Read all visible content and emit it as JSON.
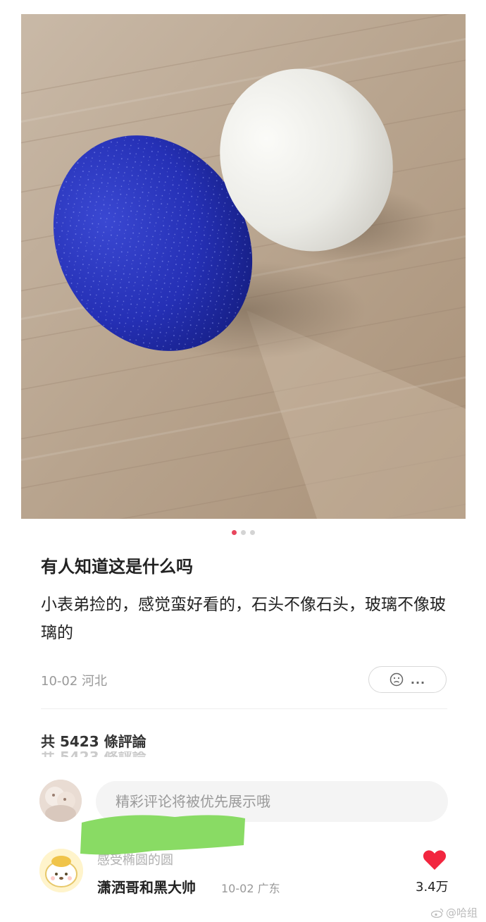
{
  "post": {
    "title": "有人知道这是什么吗",
    "body": "小表弟捡的，感觉蛮好看的，石头不像石头，玻璃不像玻璃的",
    "meta": "10-02 河北",
    "reaction_more": "..."
  },
  "carousel": {
    "total": 3,
    "active_index": 0
  },
  "comments": {
    "count_label": "共 5423 條評論",
    "input_placeholder": "精彩评论将被优先展示哦",
    "top_comment": {
      "faded_text": "感受椭圆的圆",
      "text": "潇洒哥和黑大帅",
      "time": "10-02 广东",
      "likes": "3.4万"
    }
  },
  "watermark": {
    "text": "@哈组"
  },
  "colors": {
    "accent": "#e8465d",
    "like": "#f2263f",
    "censor": "#83d95c"
  },
  "icons": [
    "face-reaction-icon",
    "heart-icon",
    "weibo-icon"
  ]
}
